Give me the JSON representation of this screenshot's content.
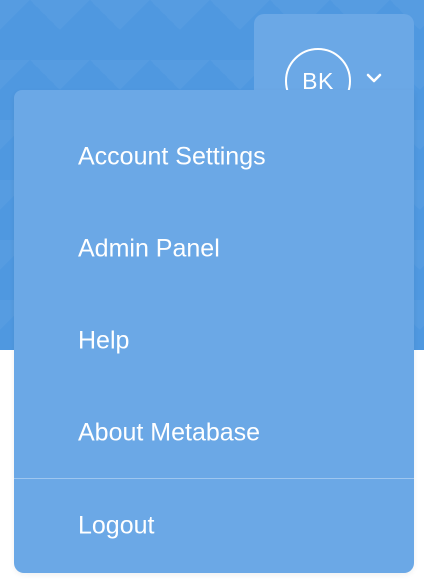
{
  "user": {
    "initials": "BK",
    "dropdown_icon": "chevron-down-icon"
  },
  "menu": {
    "items": [
      {
        "label": "Account Settings"
      },
      {
        "label": "Admin Panel"
      },
      {
        "label": "Help"
      },
      {
        "label": "About Metabase"
      },
      {
        "label": "Logout"
      }
    ]
  },
  "colors": {
    "header_background": "#4f98e0",
    "menu_background": "#6ba8e6",
    "text": "#ffffff"
  }
}
